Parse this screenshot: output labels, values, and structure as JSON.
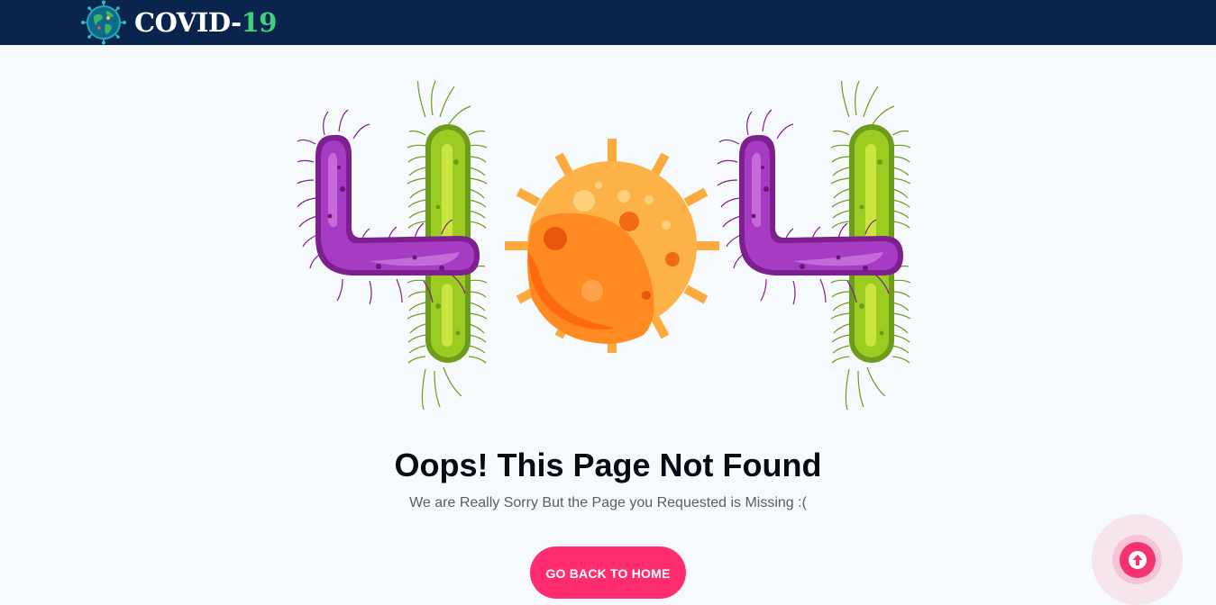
{
  "header": {
    "brand_text": "COVID-",
    "brand_number": "19",
    "logo_icon": "globe-virus-icon"
  },
  "error": {
    "code_graphic": "404",
    "title": "Oops! This Page Not Found",
    "message": "We are Really Sorry But the Page you Requested is Missing :("
  },
  "actions": {
    "home_button": "GO BACK TO HOME",
    "scroll_top_icon": "arrow-up-icon"
  },
  "colors": {
    "header_bg": "#0a244d",
    "accent": "#ff2d6f",
    "brand_number": "#3fd27a",
    "page_bg": "#f6fafc"
  }
}
